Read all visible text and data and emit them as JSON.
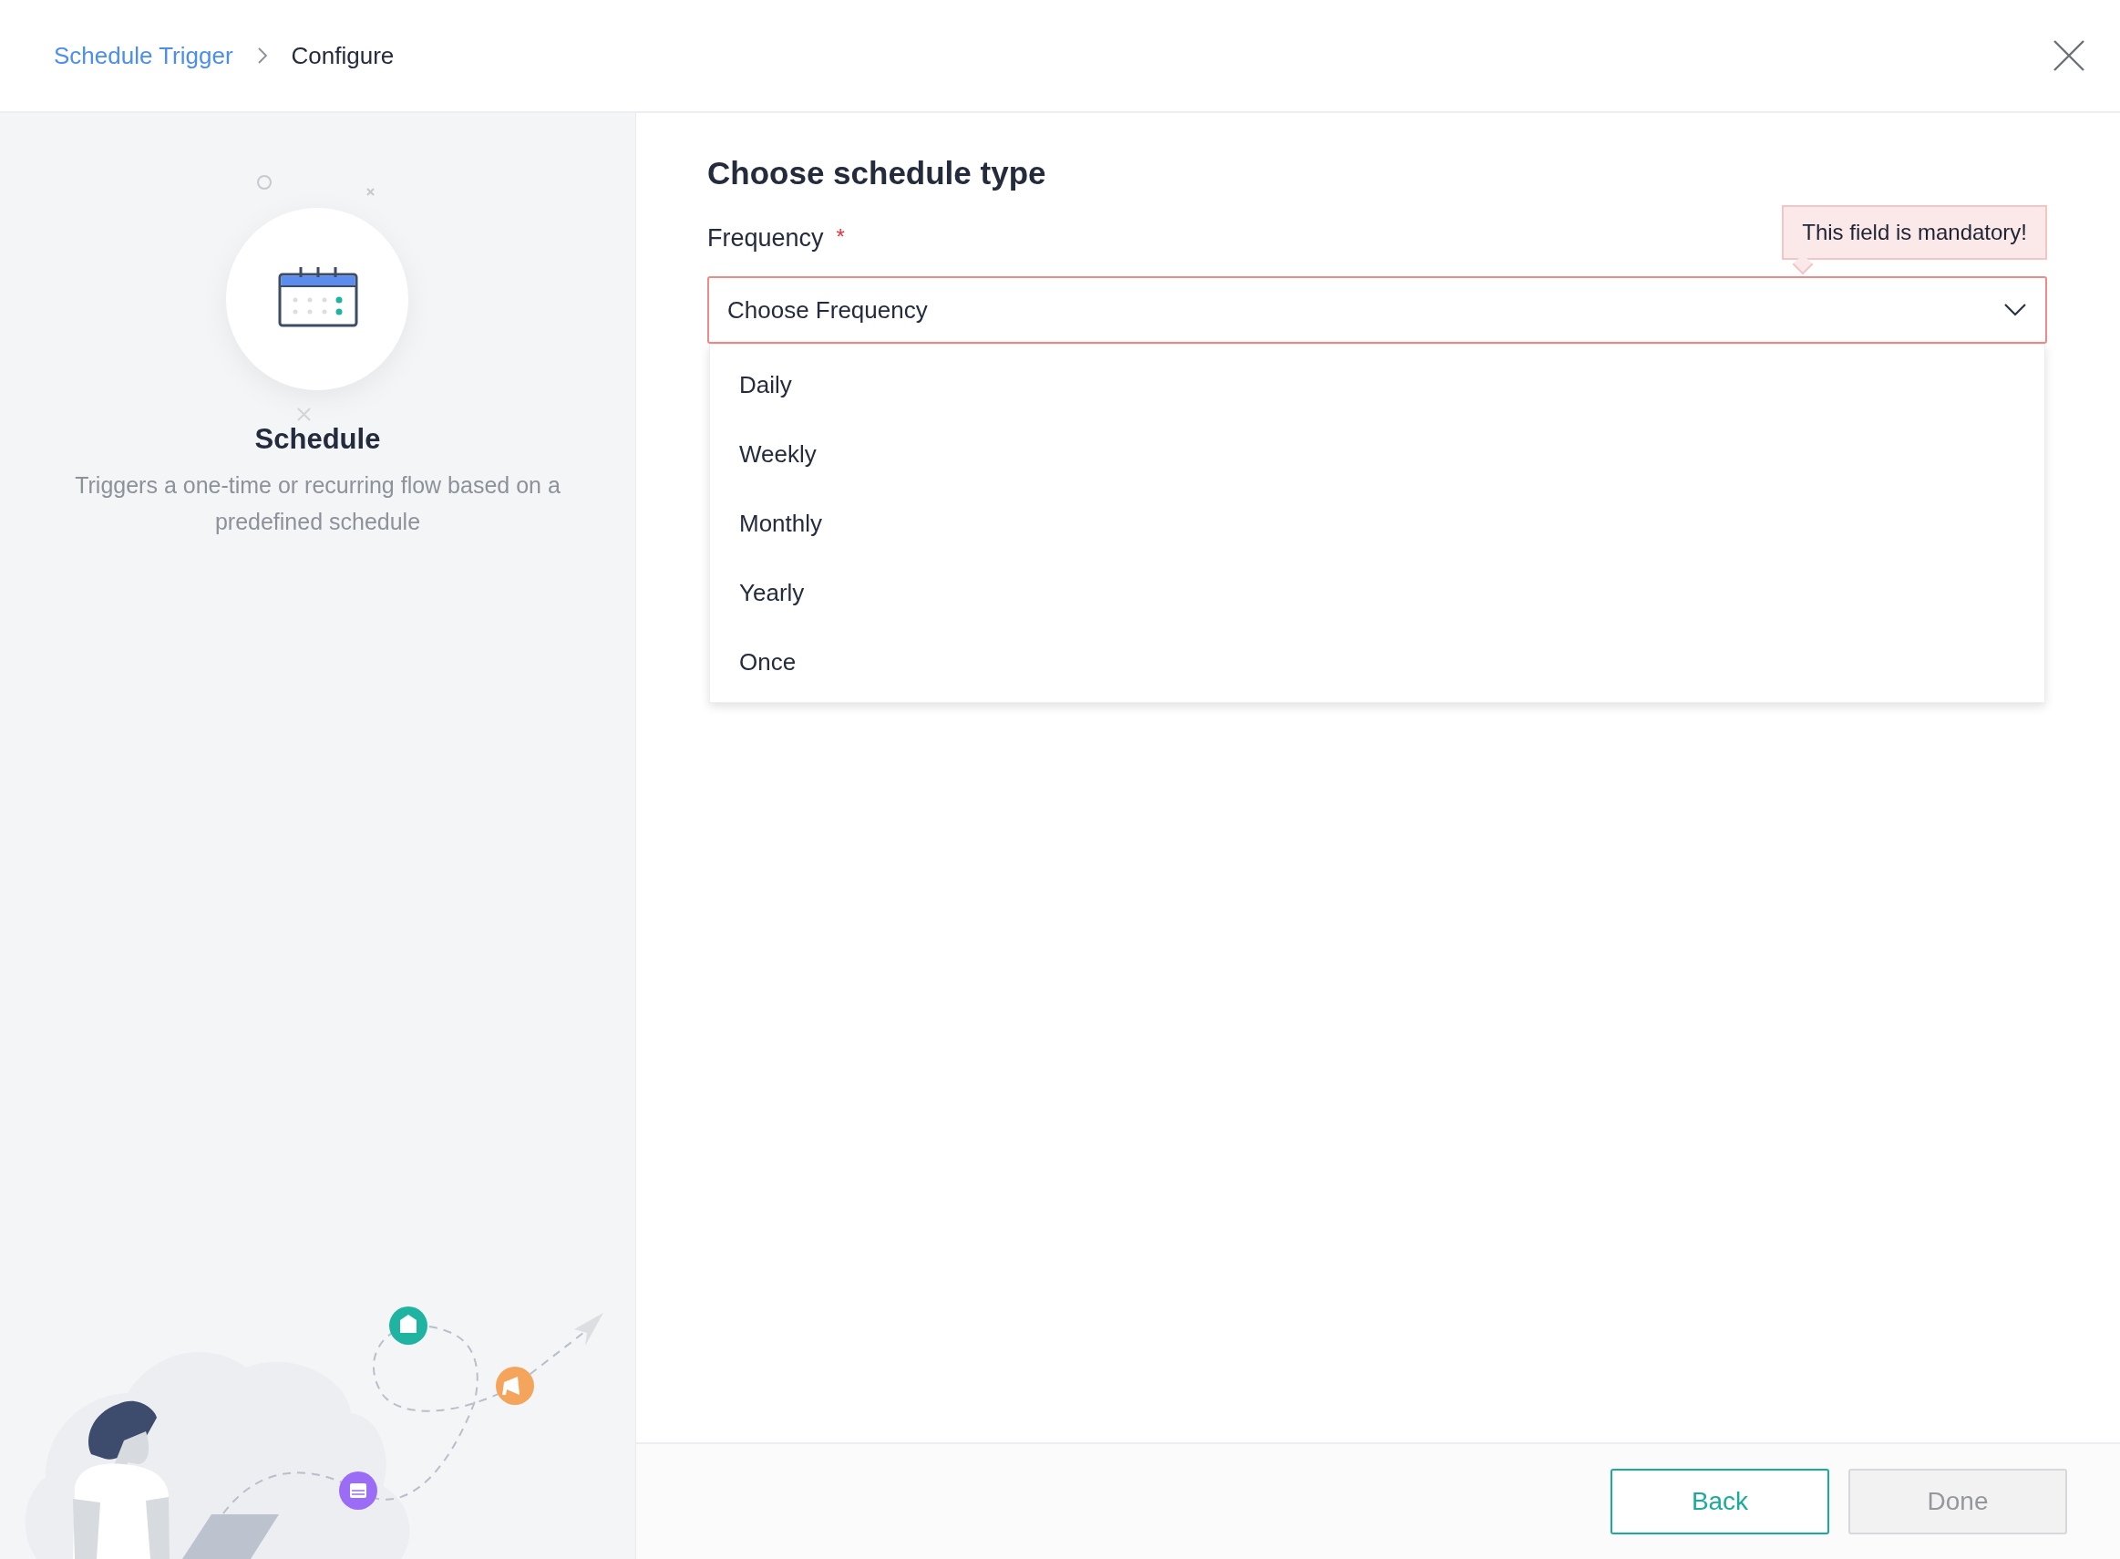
{
  "breadcrumb": [
    {
      "label": "Schedule Trigger",
      "kind": "link"
    },
    {
      "label": "Configure",
      "kind": "current"
    }
  ],
  "trigger": {
    "title": "Schedule",
    "description": "Triggers a one-time or recurring flow based on a predefined schedule"
  },
  "form": {
    "title": "Choose schedule type",
    "field": {
      "label": "Frequency",
      "required_mark": "*",
      "placeholder": "Choose Frequency",
      "error": "This field is mandatory!",
      "expanded": true,
      "options": [
        {
          "label": "Daily",
          "selected": false
        },
        {
          "label": "Weekly",
          "selected": false
        },
        {
          "label": "Monthly",
          "selected": false
        },
        {
          "label": "Yearly",
          "selected": false
        },
        {
          "label": "Once",
          "selected": false
        }
      ]
    }
  },
  "buttons": [
    {
      "label": "Back",
      "kind": "secondary",
      "disabled": false
    },
    {
      "label": "Done",
      "kind": "primary",
      "disabled": true
    }
  ]
}
